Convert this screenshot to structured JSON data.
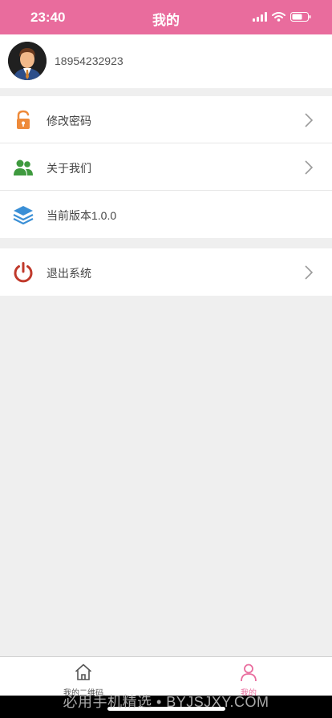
{
  "status_bar": {
    "time": "23:40"
  },
  "header": {
    "title": "我的"
  },
  "profile": {
    "phone": "18954232923"
  },
  "menu_group1": [
    {
      "label": "修改密码",
      "icon": "lock-icon",
      "has_arrow": true
    },
    {
      "label": "关于我们",
      "icon": "users-icon",
      "has_arrow": true
    },
    {
      "label": "当前版本1.0.0",
      "icon": "layers-icon",
      "has_arrow": false
    }
  ],
  "menu_group2": [
    {
      "label": "退出系统",
      "icon": "power-icon",
      "has_arrow": true
    }
  ],
  "tabbar": {
    "tabs": [
      {
        "label": "我的二维码",
        "icon": "home-icon",
        "active": false
      },
      {
        "label": "我的",
        "icon": "person-icon",
        "active": true
      }
    ]
  },
  "watermark": "必用手机精选 • BYJSJXY.COM",
  "colors": {
    "accent": "#e96c9d",
    "lock": "#ee8a3a",
    "users": "#3e9a3e",
    "layers": "#3a8fd6",
    "power": "#c0392b"
  }
}
